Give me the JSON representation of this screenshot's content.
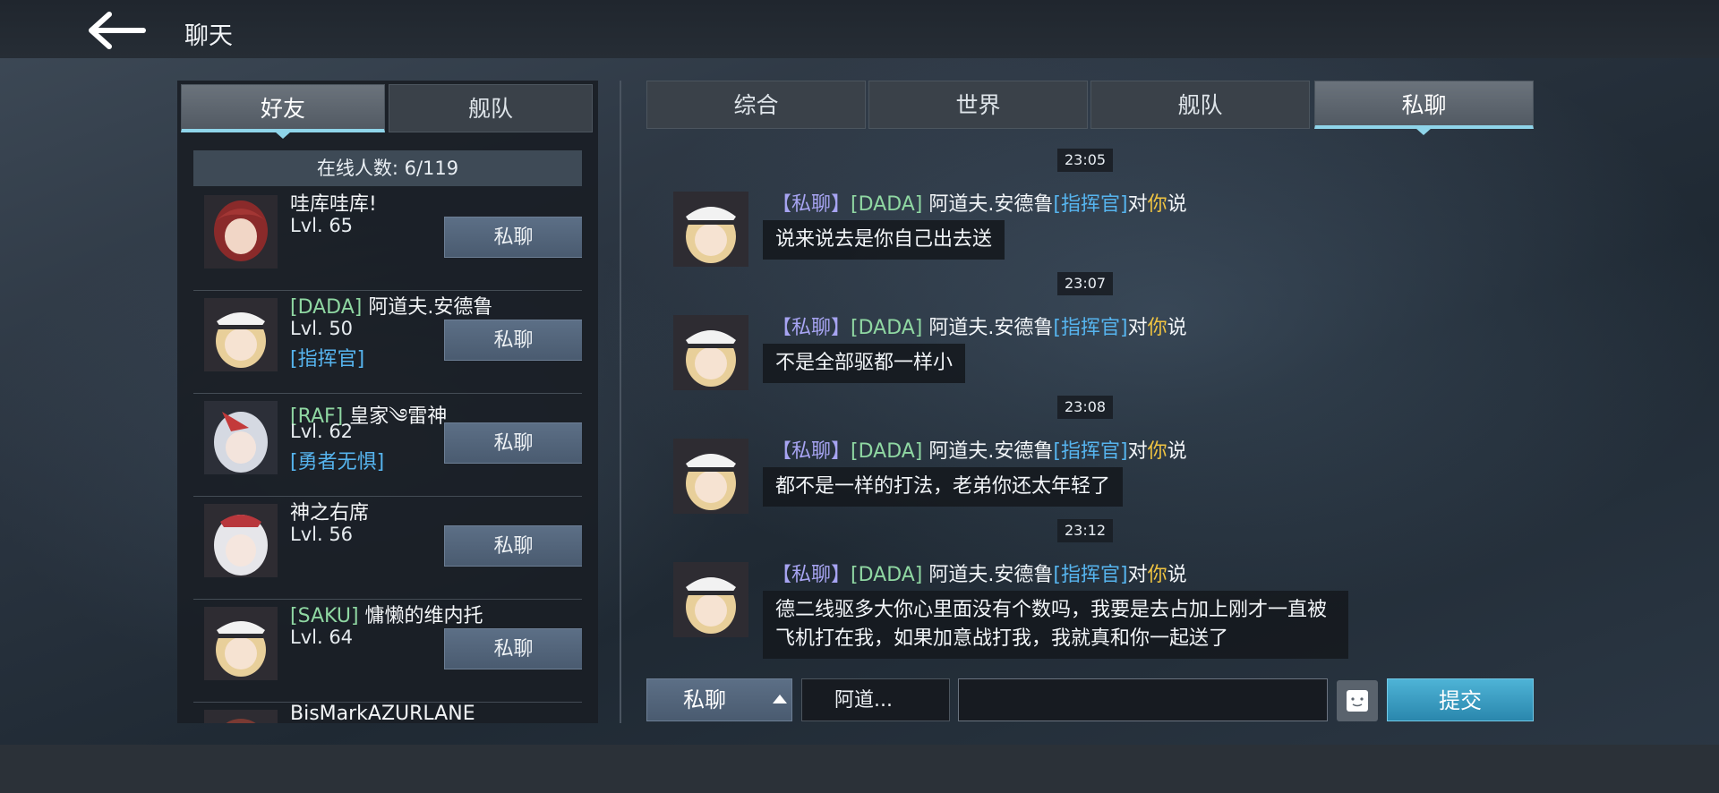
{
  "header": {
    "title": "聊天",
    "back_icon": "arrow-left-icon"
  },
  "left_tabs": [
    {
      "label": "好友",
      "active": true
    },
    {
      "label": "舰队",
      "active": false
    }
  ],
  "online_count": "在线人数: 6/119",
  "friends": [
    {
      "tag": "",
      "name": "哇库哇库!",
      "level": "Lvl. 65",
      "title": "",
      "button": "私聊"
    },
    {
      "tag": "[DADA]",
      "name": "阿道夫.安德鲁",
      "level": "Lvl. 50",
      "title": "[指挥官]",
      "button": "私聊"
    },
    {
      "tag": "[RAF]",
      "name": "皇家༄雷神",
      "level": "Lvl. 62",
      "title": "[勇者无惧]",
      "button": "私聊"
    },
    {
      "tag": "",
      "name": "神之右席",
      "level": "Lvl. 56",
      "title": "",
      "button": "私聊"
    },
    {
      "tag": "[SAKU]",
      "name": "慵懒的维内托",
      "level": "Lvl. 64",
      "title": "",
      "button": "私聊"
    },
    {
      "tag": "",
      "name": "BisMarkAZURLANE",
      "level": "",
      "title": "",
      "button": ""
    }
  ],
  "right_tabs": [
    {
      "label": "综合",
      "active": false
    },
    {
      "label": "世界",
      "active": false
    },
    {
      "label": "舰队",
      "active": false
    },
    {
      "label": "私聊",
      "active": true
    }
  ],
  "messages": [
    {
      "time": "23:05",
      "channel": "【私聊】",
      "tag": "[DADA]",
      "sender": "阿道夫.安德鲁",
      "title": "[指挥官]",
      "to": "对",
      "you": "你",
      "said": "说",
      "text": "说来说去是你自己出去送"
    },
    {
      "time": "23:07",
      "channel": "【私聊】",
      "tag": "[DADA]",
      "sender": "阿道夫.安德鲁",
      "title": "[指挥官]",
      "to": "对",
      "you": "你",
      "said": "说",
      "text": "不是全部驱都一样小"
    },
    {
      "time": "23:08",
      "channel": "【私聊】",
      "tag": "[DADA]",
      "sender": "阿道夫.安德鲁",
      "title": "[指挥官]",
      "to": "对",
      "you": "你",
      "said": "说",
      "text": "都不是一样的打法，老弟你还太年轻了"
    },
    {
      "time": "23:12",
      "channel": "【私聊】",
      "tag": "[DADA]",
      "sender": "阿道夫.安德鲁",
      "title": "[指挥官]",
      "to": "对",
      "you": "你",
      "said": "说",
      "text": "德二线驱多大你心里面没有个数吗，我要是去占加上刚才一直被飞机打在我，如果加意战打我，我就真和你一起送了"
    }
  ],
  "input_bar": {
    "mode": "私聊",
    "target": "阿道...",
    "input_value": "",
    "submit": "提交"
  },
  "colors": {
    "accent": "#8fd5ea",
    "tag": "#8fd7a2",
    "title": "#56b4ee",
    "channel": "#a7a4f2",
    "you": "#f0c441",
    "submit": "#2a87ad"
  }
}
